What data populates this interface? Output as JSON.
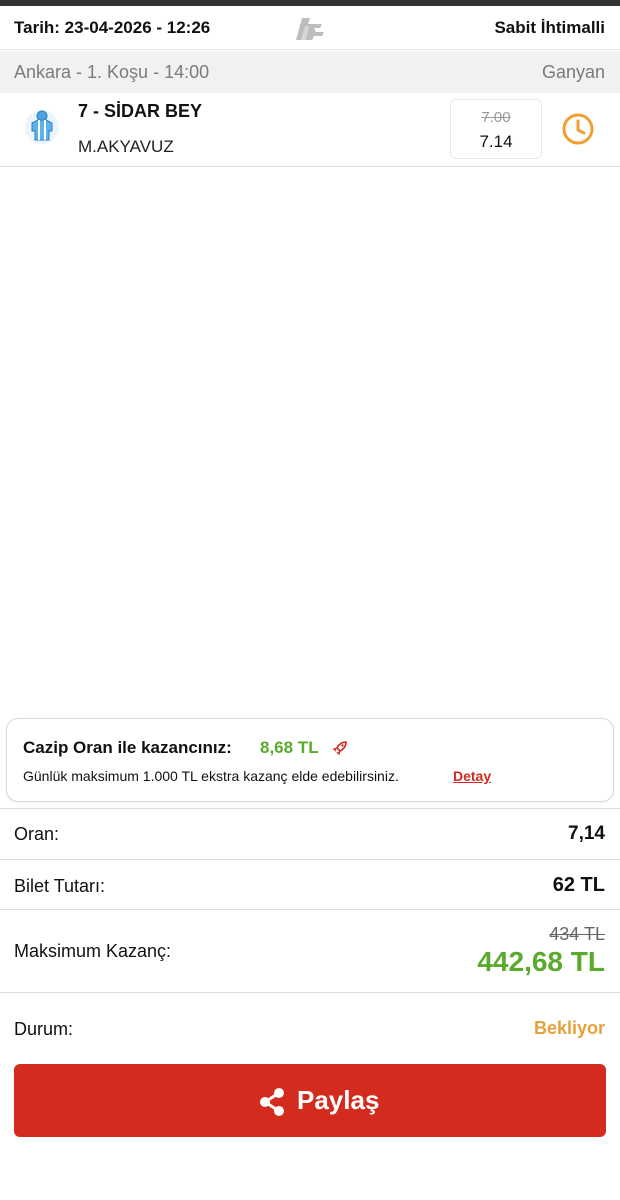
{
  "header": {
    "date": "Tarih: 23-04-2026 - 12:26",
    "mode": "Sabit İhtimalli"
  },
  "race": {
    "title": "Ankara - 1. Koşu - 14:00",
    "bet_type": "Ganyan"
  },
  "selection": {
    "horse": "7 - SİDAR BEY",
    "jockey": "M.AKYAVUZ",
    "odds_old": "7.00",
    "odds_new": "7.14"
  },
  "promo": {
    "title": "Cazip Oran ile kazancınız:",
    "amount": "8,68 TL",
    "description": "Günlük maksimum 1.000 TL ekstra kazanç elde edebilirsiniz.",
    "link": "Detay"
  },
  "summary": {
    "odds_label": "Oran:",
    "odds_value": "7,14",
    "stake_label": "Bilet Tutarı:",
    "stake_value": "62 TL",
    "max_label": "Maksimum Kazanç:",
    "max_old": "434 TL",
    "max_new": "442,68 TL",
    "status_label": "Durum:",
    "status_value": "Bekliyor"
  },
  "actions": {
    "share_label": "Paylaş"
  },
  "colors": {
    "accent_red": "#d32c1f",
    "win_green": "#5aaa2c",
    "pending_orange": "#e8a13a",
    "clock_orange": "#f0a030"
  },
  "icons": {
    "logo": "horse-logo-icon",
    "silk": "jockey-silk-icon",
    "clock": "clock-icon",
    "promo": "rocket-icon",
    "share": "share-icon"
  }
}
